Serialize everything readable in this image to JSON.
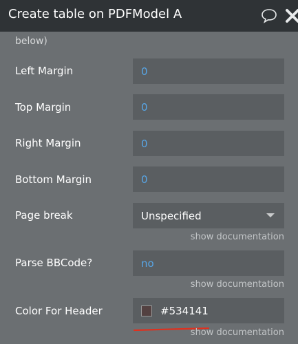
{
  "titlebar": {
    "title": "Create table on PDFModel A",
    "chat_icon": "speech-bubble-icon",
    "close_icon": "close-icon"
  },
  "overflow_text": "below)",
  "fields": {
    "left_margin": {
      "label": "Left Margin",
      "value": "0"
    },
    "top_margin": {
      "label": "Top Margin",
      "value": "0"
    },
    "right_margin": {
      "label": "Right Margin",
      "value": "0"
    },
    "bottom_margin": {
      "label": "Bottom Margin",
      "value": "0"
    },
    "page_break": {
      "label": "Page break",
      "value": "Unspecified",
      "doc": "show documentation"
    },
    "parse_bbcode": {
      "label": "Parse BBCode?",
      "value": "no",
      "doc": "show documentation"
    },
    "color_header": {
      "label": "Color For Header",
      "value": "#534141",
      "doc": "show documentation"
    }
  },
  "colors": {
    "swatch": "#534141",
    "annotation": "#e0301e"
  }
}
